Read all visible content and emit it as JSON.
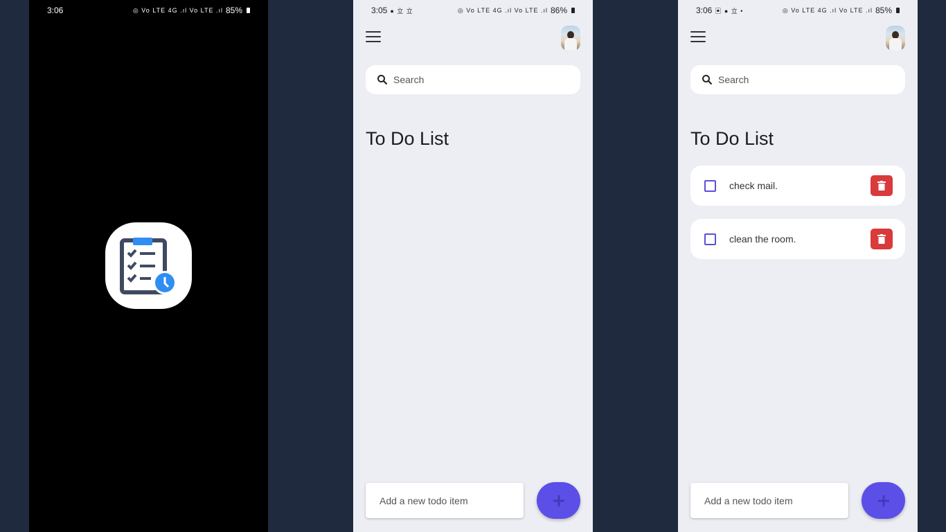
{
  "splash": {
    "status_time": "3:06",
    "status_icons": "◎ Vo LTE 4G .ıl Vo LTE .ıl",
    "battery": "85%"
  },
  "empty_screen": {
    "status_time": "3:05",
    "status_left_icons": "● 立 立",
    "status_icons": "◎ Vo LTE 4G .ıl Vo LTE .ıl",
    "battery": "86%",
    "search_placeholder": "Search",
    "title": "To Do List",
    "add_placeholder": "Add a new todo item"
  },
  "list_screen": {
    "status_time": "3:06",
    "status_left_icons": "▣ ● 立 •",
    "status_icons": "◎ Vo LTE 4G .ıl Vo LTE .ıl",
    "battery": "85%",
    "search_placeholder": "Search",
    "title": "To Do List",
    "todos": [
      {
        "text": "check mail.",
        "done": false
      },
      {
        "text": "clean the room.",
        "done": false
      }
    ],
    "add_placeholder": "Add a new todo item"
  },
  "icons": {
    "menu": "menu-icon",
    "search": "search-icon",
    "delete": "trash-icon",
    "add": "plus-icon",
    "app": "clipboard-clock-icon"
  },
  "colors": {
    "accent": "#5b4fe8",
    "delete": "#d93a3a",
    "background": "#edeef4",
    "desktop": "#1f2a3f"
  }
}
